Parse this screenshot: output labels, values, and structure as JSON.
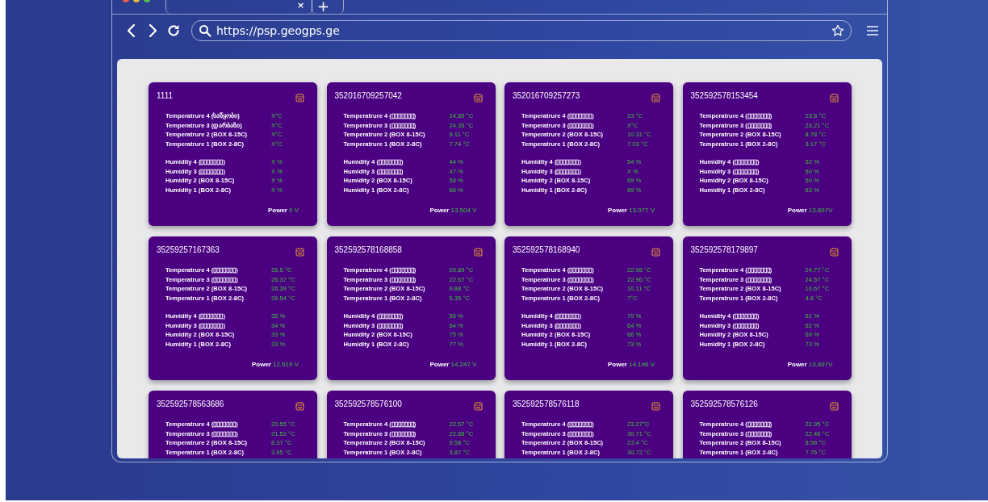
{
  "browser": {
    "tab_close": "×",
    "new_tab": "+",
    "url": "https://psp.geogps.ge"
  },
  "cards": [
    {
      "id": "1111",
      "temperatures": [
        {
          "label": "Temperatrure 4 (საწყობი)",
          "value": "X°C"
        },
        {
          "label": "Temperatrure 3 (დარბაზი)",
          "value": "X°C"
        },
        {
          "label": "Temperatrure 2 (BOX 8-15C)",
          "value": "X°C"
        },
        {
          "label": "Temperatrure 1 (BOX 2-8C)",
          "value": "X°C"
        }
      ],
      "humidities": [
        {
          "label": "Humidity 4 (▯▯▯▯▯▯▯)",
          "value": "X %"
        },
        {
          "label": "Humidity 3 (▯▯▯▯▯▯▯)",
          "value": "X %"
        },
        {
          "label": "Humidity 2 (BOX 8-15C)",
          "value": "X %"
        },
        {
          "label": "Humidity 1 (BOX 2-8C)",
          "value": "X %"
        }
      ],
      "power": {
        "label": "Power",
        "value": "0 V"
      }
    },
    {
      "id": "352016709257042",
      "temperatures": [
        {
          "label": "Temperatrure 4 (▯▯▯▯▯▯▯)",
          "value": "24.85 °C"
        },
        {
          "label": "Temperatrure 3 (▯▯▯▯▯▯▯)",
          "value": "24.35 °C"
        },
        {
          "label": "Temperatrure 2 (BOX 8-15C)",
          "value": "9.11 °C"
        },
        {
          "label": "Temperatrure 1 (BOX 2-8C)",
          "value": "7.74 °C"
        }
      ],
      "humidities": [
        {
          "label": "Humidity 4 (▯▯▯▯▯▯▯)",
          "value": "44 %"
        },
        {
          "label": "Humidity 3 (▯▯▯▯▯▯▯)",
          "value": "47 %"
        },
        {
          "label": "Humidity 2 (BOX 8-15C)",
          "value": "58 %"
        },
        {
          "label": "Humidity 1 (BOX 2-8C)",
          "value": "66 %"
        }
      ],
      "power": {
        "label": "Power",
        "value": "13.504 V"
      }
    },
    {
      "id": "352016709257273",
      "temperatures": [
        {
          "label": "Temperatrure 4 (▯▯▯▯▯▯▯)",
          "value": "23 °C"
        },
        {
          "label": "Temperatrure 3 (▯▯▯▯▯▯▯)",
          "value": "X°C"
        },
        {
          "label": "Temperatrure 2 (BOX 8-15C)",
          "value": "10.31 °C"
        },
        {
          "label": "Temperatrure 1 (BOX 2-8C)",
          "value": "7.03 °C"
        }
      ],
      "humidities": [
        {
          "label": "Humidity 4 (▯▯▯▯▯▯▯)",
          "value": "54 %"
        },
        {
          "label": "Humidity 3 (▯▯▯▯▯▯▯)",
          "value": "X %"
        },
        {
          "label": "Humidity 2 (BOX 8-15C)",
          "value": "69 %"
        },
        {
          "label": "Humidity 1 (BOX 2-8C)",
          "value": "69 %"
        }
      ],
      "power": {
        "label": "Power",
        "value": "13.077 V"
      }
    },
    {
      "id": "352592578153454",
      "temperatures": [
        {
          "label": "Temperatrure 4 (▯▯▯▯▯▯▯)",
          "value": "23.8 °C"
        },
        {
          "label": "Temperatrure 3 (▯▯▯▯▯▯▯)",
          "value": "23.21 °C"
        },
        {
          "label": "Temperatrure 2 (BOX 8-15C)",
          "value": "8.78 °C"
        },
        {
          "label": "Temperatrure 1 (BOX 2-8C)",
          "value": "3.17 °C"
        }
      ],
      "humidities": [
        {
          "label": "Humidity 4 (▯▯▯▯▯▯▯)",
          "value": "52 %"
        },
        {
          "label": "Humidity 3 (▯▯▯▯▯▯▯)",
          "value": "60 %"
        },
        {
          "label": "Humidity 2 (BOX 8-15C)",
          "value": "60 %"
        },
        {
          "label": "Humidity 1 (BOX 2-8C)",
          "value": "63 %"
        }
      ],
      "power": {
        "label": "Power",
        "value": "13.897V"
      }
    },
    {
      "id": "35259257167363",
      "temperatures": [
        {
          "label": "Temperatrure 4 (▯▯▯▯▯▯▯)",
          "value": "26.5 °C"
        },
        {
          "label": "Temperatrure 3 (▯▯▯▯▯▯▯)",
          "value": "26.37 °C"
        },
        {
          "label": "Temperatrure 2 (BOX 8-15C)",
          "value": "26.39 °C"
        },
        {
          "label": "Temperatrure 1 (BOX 2-8C)",
          "value": "26.54 °C"
        }
      ],
      "humidities": [
        {
          "label": "Humidity 4 (▯▯▯▯▯▯▯)",
          "value": "35 %"
        },
        {
          "label": "Humidity 3 (▯▯▯▯▯▯▯)",
          "value": "34 %"
        },
        {
          "label": "Humidity 2 (BOX 8-15C)",
          "value": "33 %"
        },
        {
          "label": "Humidity 1 (BOX 2-8C)",
          "value": "33 %"
        }
      ],
      "power": {
        "label": "Power",
        "value": "12.519 V"
      }
    },
    {
      "id": "352592578168858",
      "temperatures": [
        {
          "label": "Temperatrure 4 (▯▯▯▯▯▯▯)",
          "value": "20.89 °C"
        },
        {
          "label": "Temperatrure 3 (▯▯▯▯▯▯▯)",
          "value": "22.67 °C"
        },
        {
          "label": "Temperatrure 2 (BOX 8-15C)",
          "value": "9.88 °C"
        },
        {
          "label": "Temperatrure 1 (BOX 2-8C)",
          "value": "5.35 °C"
        }
      ],
      "humidities": [
        {
          "label": "Humidity 4 (▯▯▯▯▯▯▯)",
          "value": "56 %"
        },
        {
          "label": "Humidity 3 (▯▯▯▯▯▯▯)",
          "value": "64 %"
        },
        {
          "label": "Humidity 2 (BOX 8-15C)",
          "value": "75 %"
        },
        {
          "label": "Humidity 1 (BOX 2-8C)",
          "value": "77 %"
        }
      ],
      "power": {
        "label": "Power",
        "value": "14.247 V"
      }
    },
    {
      "id": "352592578168940",
      "temperatures": [
        {
          "label": "Temperatrure 4 (▯▯▯▯▯▯▯)",
          "value": "22.98 °C"
        },
        {
          "label": "Temperatrure 3 (▯▯▯▯▯▯▯)",
          "value": "22.96 °C"
        },
        {
          "label": "Temperatrure 2 (BOX 8-15C)",
          "value": "10.11 °C"
        },
        {
          "label": "Temperatrure 1 (BOX 2-8C)",
          "value": "7°C"
        }
      ],
      "humidities": [
        {
          "label": "Humidity 4 (▯▯▯▯▯▯▯)",
          "value": "70 %"
        },
        {
          "label": "Humidity 3 (▯▯▯▯▯▯▯)",
          "value": "64 %"
        },
        {
          "label": "Humidity 2 (BOX 8-15C)",
          "value": "66 %"
        },
        {
          "label": "Humidity 1 (BOX 2-8C)",
          "value": "73 %"
        }
      ],
      "power": {
        "label": "Power",
        "value": "14.196 V"
      }
    },
    {
      "id": "352592578179897",
      "temperatures": [
        {
          "label": "Temperatrure 4 (▯▯▯▯▯▯▯)",
          "value": "24.77 °C"
        },
        {
          "label": "Temperatrure 3 (▯▯▯▯▯▯▯)",
          "value": "24.57 °C"
        },
        {
          "label": "Temperatrure 2 (BOX 8-15C)",
          "value": "10.67 °C"
        },
        {
          "label": "Temperatrure 1 (BOX 2-8C)",
          "value": "4.8 °C"
        }
      ],
      "humidities": [
        {
          "label": "Humidity 4 (▯▯▯▯▯▯▯)",
          "value": "61 %"
        },
        {
          "label": "Humidity 3 (▯▯▯▯▯▯▯)",
          "value": "62 %"
        },
        {
          "label": "Humidity 2 (BOX 8-15C)",
          "value": "69 %"
        },
        {
          "label": "Humidity 1 (BOX 2-8C)",
          "value": "73 %"
        }
      ],
      "power": {
        "label": "Power",
        "value": "13.897V"
      }
    },
    {
      "id": "352592578563686",
      "temperatures": [
        {
          "label": "Temperatrure 4 (▯▯▯▯▯▯▯)",
          "value": "20.55 °C"
        },
        {
          "label": "Temperatrure 3 (▯▯▯▯▯▯▯)",
          "value": "21.52 °C"
        },
        {
          "label": "Temperatrure 2 (BOX 8-15C)",
          "value": "8.37 °C"
        },
        {
          "label": "Temperatrure 1 (BOX 2-8C)",
          "value": "3.95 °C"
        }
      ]
    },
    {
      "id": "352592578576100",
      "temperatures": [
        {
          "label": "Temperatrure 4 (▯▯▯▯▯▯▯)",
          "value": "22.57 °C"
        },
        {
          "label": "Temperatrure 3 (▯▯▯▯▯▯▯)",
          "value": "22.88 °C"
        },
        {
          "label": "Temperatrure 2 (BOX 8-15C)",
          "value": "9.58 °C"
        },
        {
          "label": "Temperatrure 1 (BOX 2-8C)",
          "value": "3.87 °C"
        }
      ]
    },
    {
      "id": "352592578576118",
      "temperatures": [
        {
          "label": "Temperatrure 4 (▯▯▯▯▯▯▯)",
          "value": "23.27°C"
        },
        {
          "label": "Temperatrure 3 (▯▯▯▯▯▯▯)",
          "value": "30.71 °C"
        },
        {
          "label": "Temperatrure 2 (BOX 8-15C)",
          "value": "23.4 °C"
        },
        {
          "label": "Temperatrure 1 (BOX 2-8C)",
          "value": "30.72 °C"
        }
      ]
    },
    {
      "id": "352592578576126",
      "temperatures": [
        {
          "label": "Temperatrure 4 (▯▯▯▯▯▯▯)",
          "value": "22.95 °C"
        },
        {
          "label": "Temperatrure 3 (▯▯▯▯▯▯▯)",
          "value": "22.46 °C"
        },
        {
          "label": "Temperatrure 2 (BOX 8-15C)",
          "value": "8.58 °C"
        },
        {
          "label": "Temperatrure 1 (BOX 2-8C)",
          "value": "7.76 °C"
        }
      ]
    }
  ]
}
